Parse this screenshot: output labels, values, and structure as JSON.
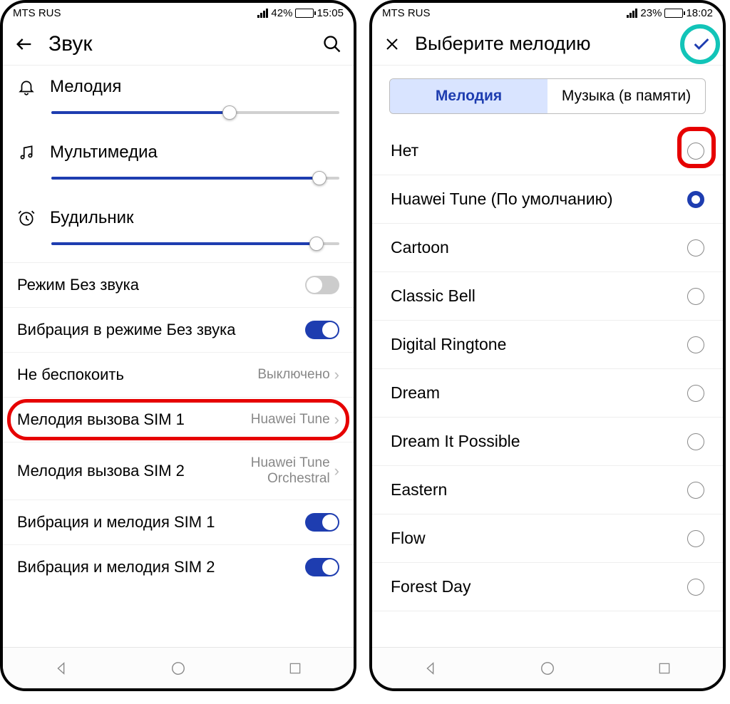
{
  "left": {
    "status": {
      "carrier": "MTS RUS",
      "battery_pct": "42%",
      "time": "15:05",
      "battery_fill": 42
    },
    "header": {
      "title": "Звук"
    },
    "volumes": {
      "ringtone": {
        "label": "Мелодия",
        "value": 62
      },
      "media": {
        "label": "Мультимедиа",
        "value": 93
      },
      "alarm": {
        "label": "Будильник",
        "value": 92
      }
    },
    "settings": {
      "silent": {
        "label": "Режим Без звука",
        "on": false
      },
      "vibrate_silent": {
        "label": "Вибрация в режиме Без звука",
        "on": true
      },
      "dnd": {
        "label": "Не беспокоить",
        "value": "Выключено"
      },
      "sim1_ringtone": {
        "label": "Мелодия вызова SIM 1",
        "value": "Huawei Tune"
      },
      "sim2_ringtone": {
        "label": "Мелодия вызова SIM 2",
        "value": "Huawei Tune Orchestral"
      },
      "vibrate_sim1": {
        "label": "Вибрация и мелодия SIM 1",
        "on": true
      },
      "vibrate_sim2": {
        "label": "Вибрация и мелодия SIM 2",
        "on": true
      }
    }
  },
  "right": {
    "status": {
      "carrier": "MTS RUS",
      "battery_pct": "23%",
      "time": "18:02",
      "battery_fill": 23
    },
    "header": {
      "title": "Выберите мелодию"
    },
    "tabs": {
      "melody": "Мелодия",
      "music": "Музыка (в памяти)"
    },
    "items": [
      {
        "label": "Нет",
        "selected": false
      },
      {
        "label": "Huawei Tune (По умолчанию)",
        "selected": true
      },
      {
        "label": "Cartoon",
        "selected": false
      },
      {
        "label": "Classic Bell",
        "selected": false
      },
      {
        "label": "Digital Ringtone",
        "selected": false
      },
      {
        "label": "Dream",
        "selected": false
      },
      {
        "label": "Dream It Possible",
        "selected": false
      },
      {
        "label": "Eastern",
        "selected": false
      },
      {
        "label": "Flow",
        "selected": false
      },
      {
        "label": "Forest Day",
        "selected": false
      }
    ]
  }
}
